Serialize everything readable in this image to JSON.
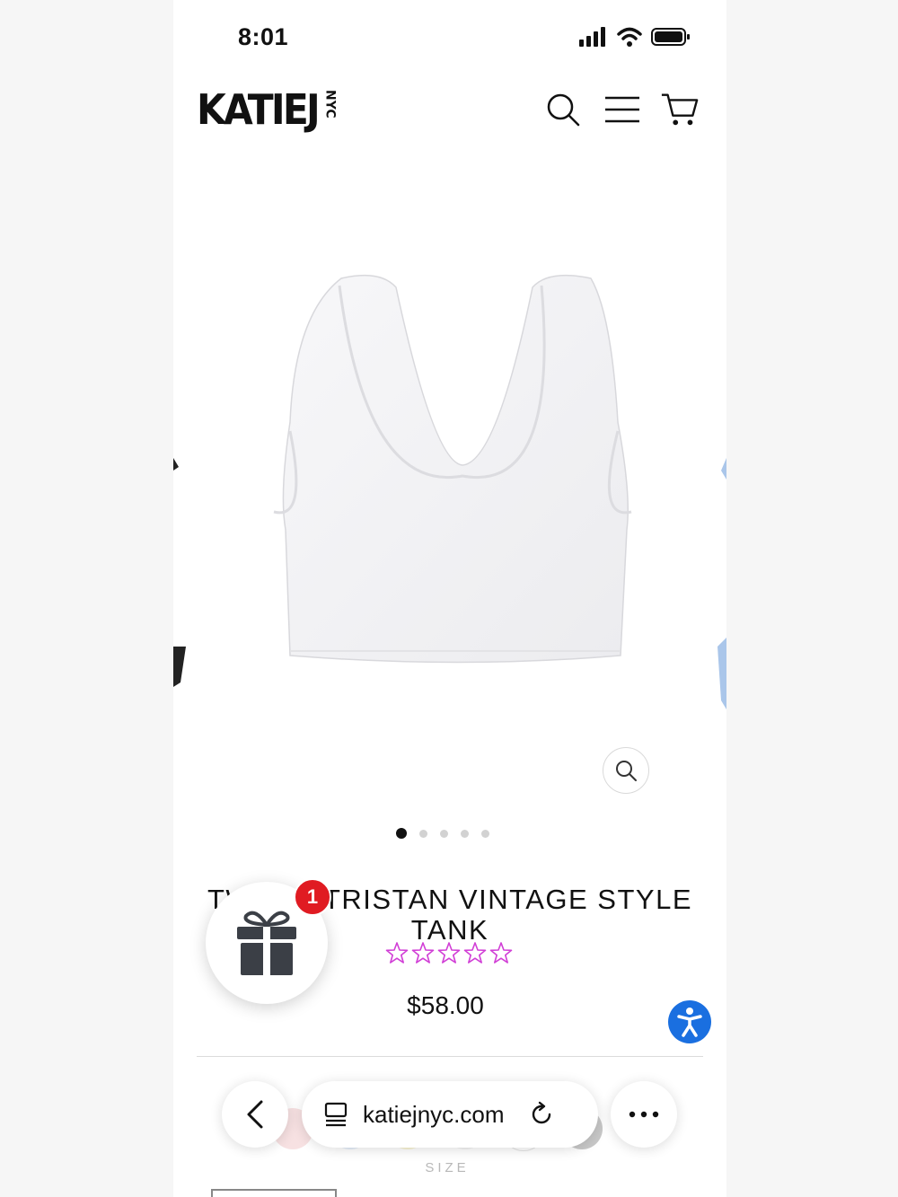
{
  "status_bar": {
    "time": "8:01"
  },
  "header": {
    "logo_main": "KATIEJ",
    "logo_sub": "NYC",
    "icons": [
      "search-icon",
      "menu-icon",
      "cart-icon"
    ]
  },
  "gallery": {
    "image_icon": "white-ribbed-tank-top",
    "slide_count": 5,
    "active_slide": 1
  },
  "product": {
    "title": "TWEEN TRISTAN VINTAGE STYLE TANK",
    "rating_stars": 5,
    "rating_color": "#d13ed6",
    "price": "$58.00"
  },
  "gift_widget": {
    "icon": "gift-icon",
    "badge_count": "1",
    "badge_color": "#e01b22"
  },
  "accessibility": {
    "icon": "accessibility-icon",
    "color": "#1a6fe0"
  },
  "variants": {
    "size_label": "SIZE"
  },
  "browser": {
    "url": "katiejnyc.com",
    "icons": [
      "back-icon",
      "tabs-icon",
      "reload-icon",
      "more-icon"
    ]
  }
}
